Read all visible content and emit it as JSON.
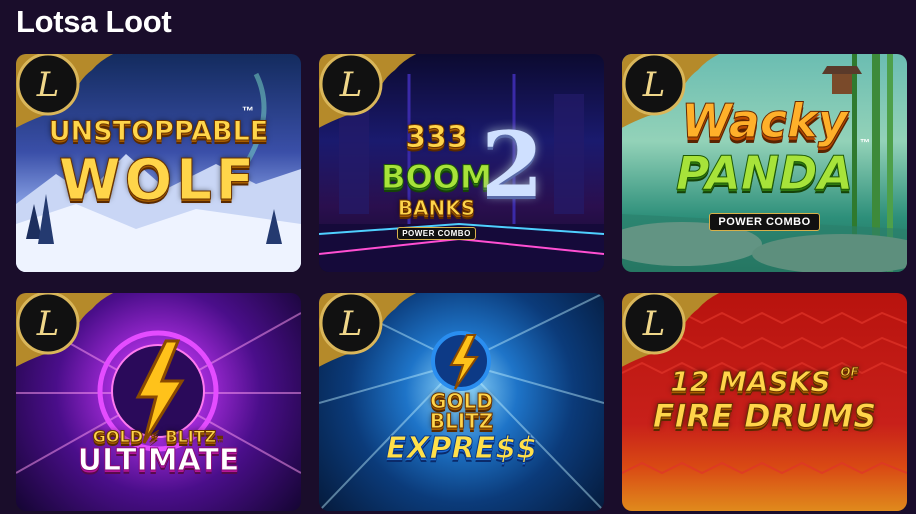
{
  "section": {
    "title": "Lotsa Loot"
  },
  "badge": {
    "letter": "L"
  },
  "games": [
    {
      "line1": "UNSTOPPABLE",
      "line2": "WOLF",
      "tm": "™"
    },
    {
      "num": "333",
      "line1": "BOOM",
      "line2": "BANKS",
      "sub": "POWER COMBO",
      "big": "2"
    },
    {
      "line1": "Wacky",
      "line2": "PANDA",
      "sub": "POWER COMBO",
      "tm": "™"
    },
    {
      "line1": "GOLD",
      "mid": "BLITZ",
      "line2": "ULTIMATE",
      "tm": "™"
    },
    {
      "line1": "GOLD",
      "mid": "BLITZ",
      "line2": "EXPRE$$"
    },
    {
      "line1": "12 MASKS",
      "of": "OF",
      "line2": "FIRE DRUMS"
    }
  ]
}
